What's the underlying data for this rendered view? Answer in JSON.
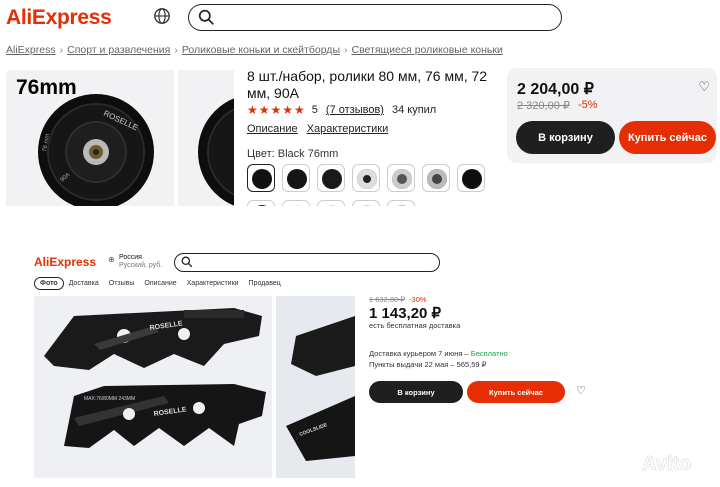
{
  "panel1": {
    "logo": "AliExpress",
    "search": {
      "placeholder": ""
    },
    "breadcrumbs": [
      "AliExpress",
      "Спорт и развлечения",
      "Роликовые коньки и скейтборды",
      "Светящиеся роликовые коньки"
    ],
    "image_label": "76mm",
    "title": "8 шт./набор, ролики 80 мм, 76 мм, 72 мм, 90A",
    "rating": {
      "stars": "★★★★★",
      "value": "5",
      "reviews": "(7 отзывов)",
      "sold": "34 купил"
    },
    "tabs": [
      "Описание",
      "Характеристики"
    ],
    "color_label": "Цвет: Black 76mm",
    "price": "2 204,00 ₽",
    "old_price": "2 320,00 ₽",
    "discount": "-5%",
    "buttons": {
      "cart": "В корзину",
      "buy": "Купить сейчас"
    },
    "icons": {
      "globe": "globe-icon",
      "search": "search-icon",
      "wishlist": "heart-icon"
    },
    "colors": {
      "brand": "#e62e04",
      "dark_button": "#1f1f1f"
    }
  },
  "panel2": {
    "logo": "AliExpress",
    "region": {
      "country": "Россия",
      "sub": "Русский, руб."
    },
    "search": {
      "placeholder": ""
    },
    "tabs": [
      "Фото",
      "Доставка",
      "Отзывы",
      "Описание",
      "Характеристики",
      "Продавец"
    ],
    "active_tab": "Фото",
    "old_price": "1 632,80 ₽",
    "discount": "-30%",
    "price": "1 143,20 ₽",
    "shipping": "есть бесплатная доставка",
    "delivery_prefix": "Доставка курьером 7 июня – ",
    "delivery_free": "Бесплатно",
    "pickup": "Пункты выдачи 22 мая – 565,59 ₽",
    "buttons": {
      "cart": "В корзину",
      "buy": "Купить сейчас"
    },
    "image_texts": {
      "frame_top": "ROSELLE",
      "frame_bottom": "ROSELLE",
      "spec": "MAX:76/80MM 243MM",
      "side_brand": "COOLSLIDE"
    },
    "colors": {
      "free_delivery": "#1a9e47"
    }
  },
  "watermark": "Avito"
}
